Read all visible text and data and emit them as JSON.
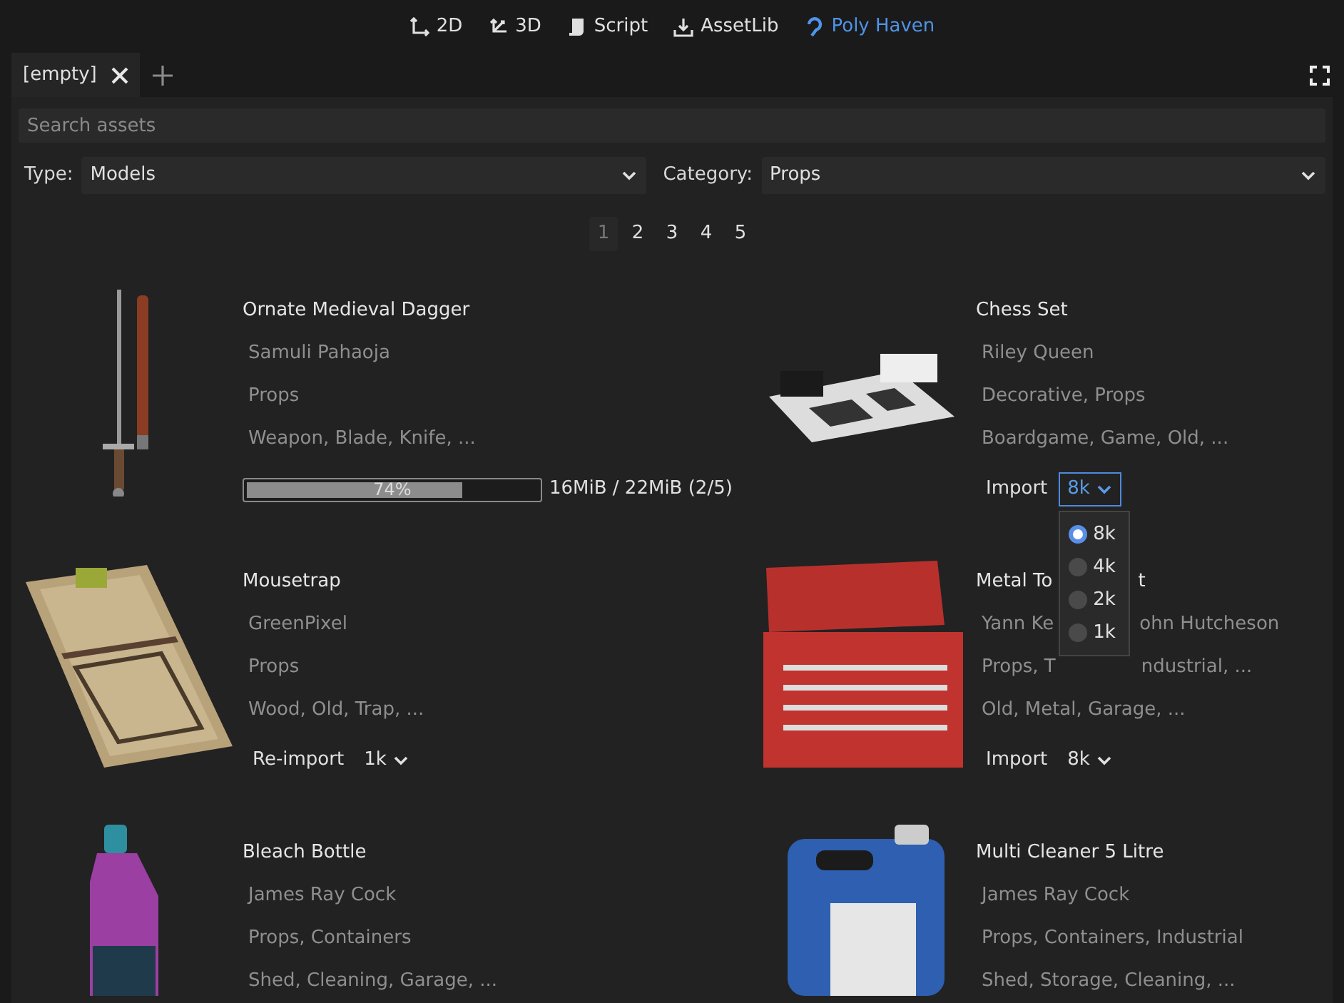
{
  "top_tabs": [
    {
      "label": "2D",
      "selected": false
    },
    {
      "label": "3D",
      "selected": false
    },
    {
      "label": "Script",
      "selected": false
    },
    {
      "label": "AssetLib",
      "selected": false
    },
    {
      "label": "Poly Haven",
      "selected": true
    }
  ],
  "scene_tabs": [
    {
      "label": "[empty]",
      "selected": true
    }
  ],
  "search": {
    "placeholder": "Search assets"
  },
  "filters": [
    {
      "label": "Type:",
      "value": "Models"
    },
    {
      "label": "Category:",
      "value": "Props"
    }
  ],
  "pages": [
    {
      "label": "1",
      "selected": true
    },
    {
      "label": "2",
      "selected": false
    },
    {
      "label": "3",
      "selected": false
    },
    {
      "label": "4",
      "selected": false
    },
    {
      "label": "5",
      "selected": false
    }
  ],
  "assets": [
    {
      "kind": "picture",
      "title": [
        "Ornate Medieval Dagger"
      ],
      "author": [
        "Samuli Pahaoja"
      ],
      "categories": [
        "Props"
      ],
      "tags": [
        "Weapon, Blade, Knife, ..."
      ],
      "action": {
        "kind": "progress",
        "level": 0.74,
        "label": "74%",
        "size": "16MiB / 22MiB (2/5)"
      }
    },
    {
      "kind": "picture",
      "title": [
        "Chess Set"
      ],
      "author": [
        "Riley Queen"
      ],
      "categories": [
        "Decorative, Props"
      ],
      "tags": [
        "Boardgame, Game, Old, ..."
      ],
      "action": {
        "kind": "import",
        "button": "Import",
        "resolution": "8k",
        "open": true,
        "options": [
          {
            "label": "8k",
            "selected": true
          },
          {
            "label": "4k",
            "selected": false
          },
          {
            "label": "2k",
            "selected": false
          },
          {
            "label": "1k",
            "selected": false
          }
        ]
      }
    },
    {
      "kind": "picture",
      "title": [
        "Mousetrap"
      ],
      "author": [
        "GreenPixel"
      ],
      "categories": [
        "Props"
      ],
      "tags": [
        "Wood, Old, Trap, ..."
      ],
      "action": {
        "kind": "import",
        "button": "Re-import",
        "resolution": "1k",
        "open": false
      }
    },
    {
      "kind": "picture",
      "title": [
        "Metal To",
        "t"
      ],
      "author": [
        "Yann Ke",
        "ohn Hutcheson"
      ],
      "categories": [
        "Props, T",
        "ndustrial, ..."
      ],
      "tags": [
        "Old, Metal, Garage, ..."
      ],
      "action": {
        "kind": "import",
        "button": "Import",
        "resolution": "8k",
        "open": false
      }
    },
    {
      "kind": "picture",
      "title": [
        "Bleach Bottle"
      ],
      "author": [
        "James Ray Cock"
      ],
      "categories": [
        "Props, Containers"
      ],
      "tags": [
        "Shed, Cleaning, Garage, ..."
      ]
    },
    {
      "kind": "picture",
      "title": [
        "Multi Cleaner 5 Litre"
      ],
      "author": [
        "James Ray Cock"
      ],
      "categories": [
        "Props, Containers, Industrial"
      ],
      "tags": [
        "Shed, Storage, Cleaning, ..."
      ]
    }
  ]
}
